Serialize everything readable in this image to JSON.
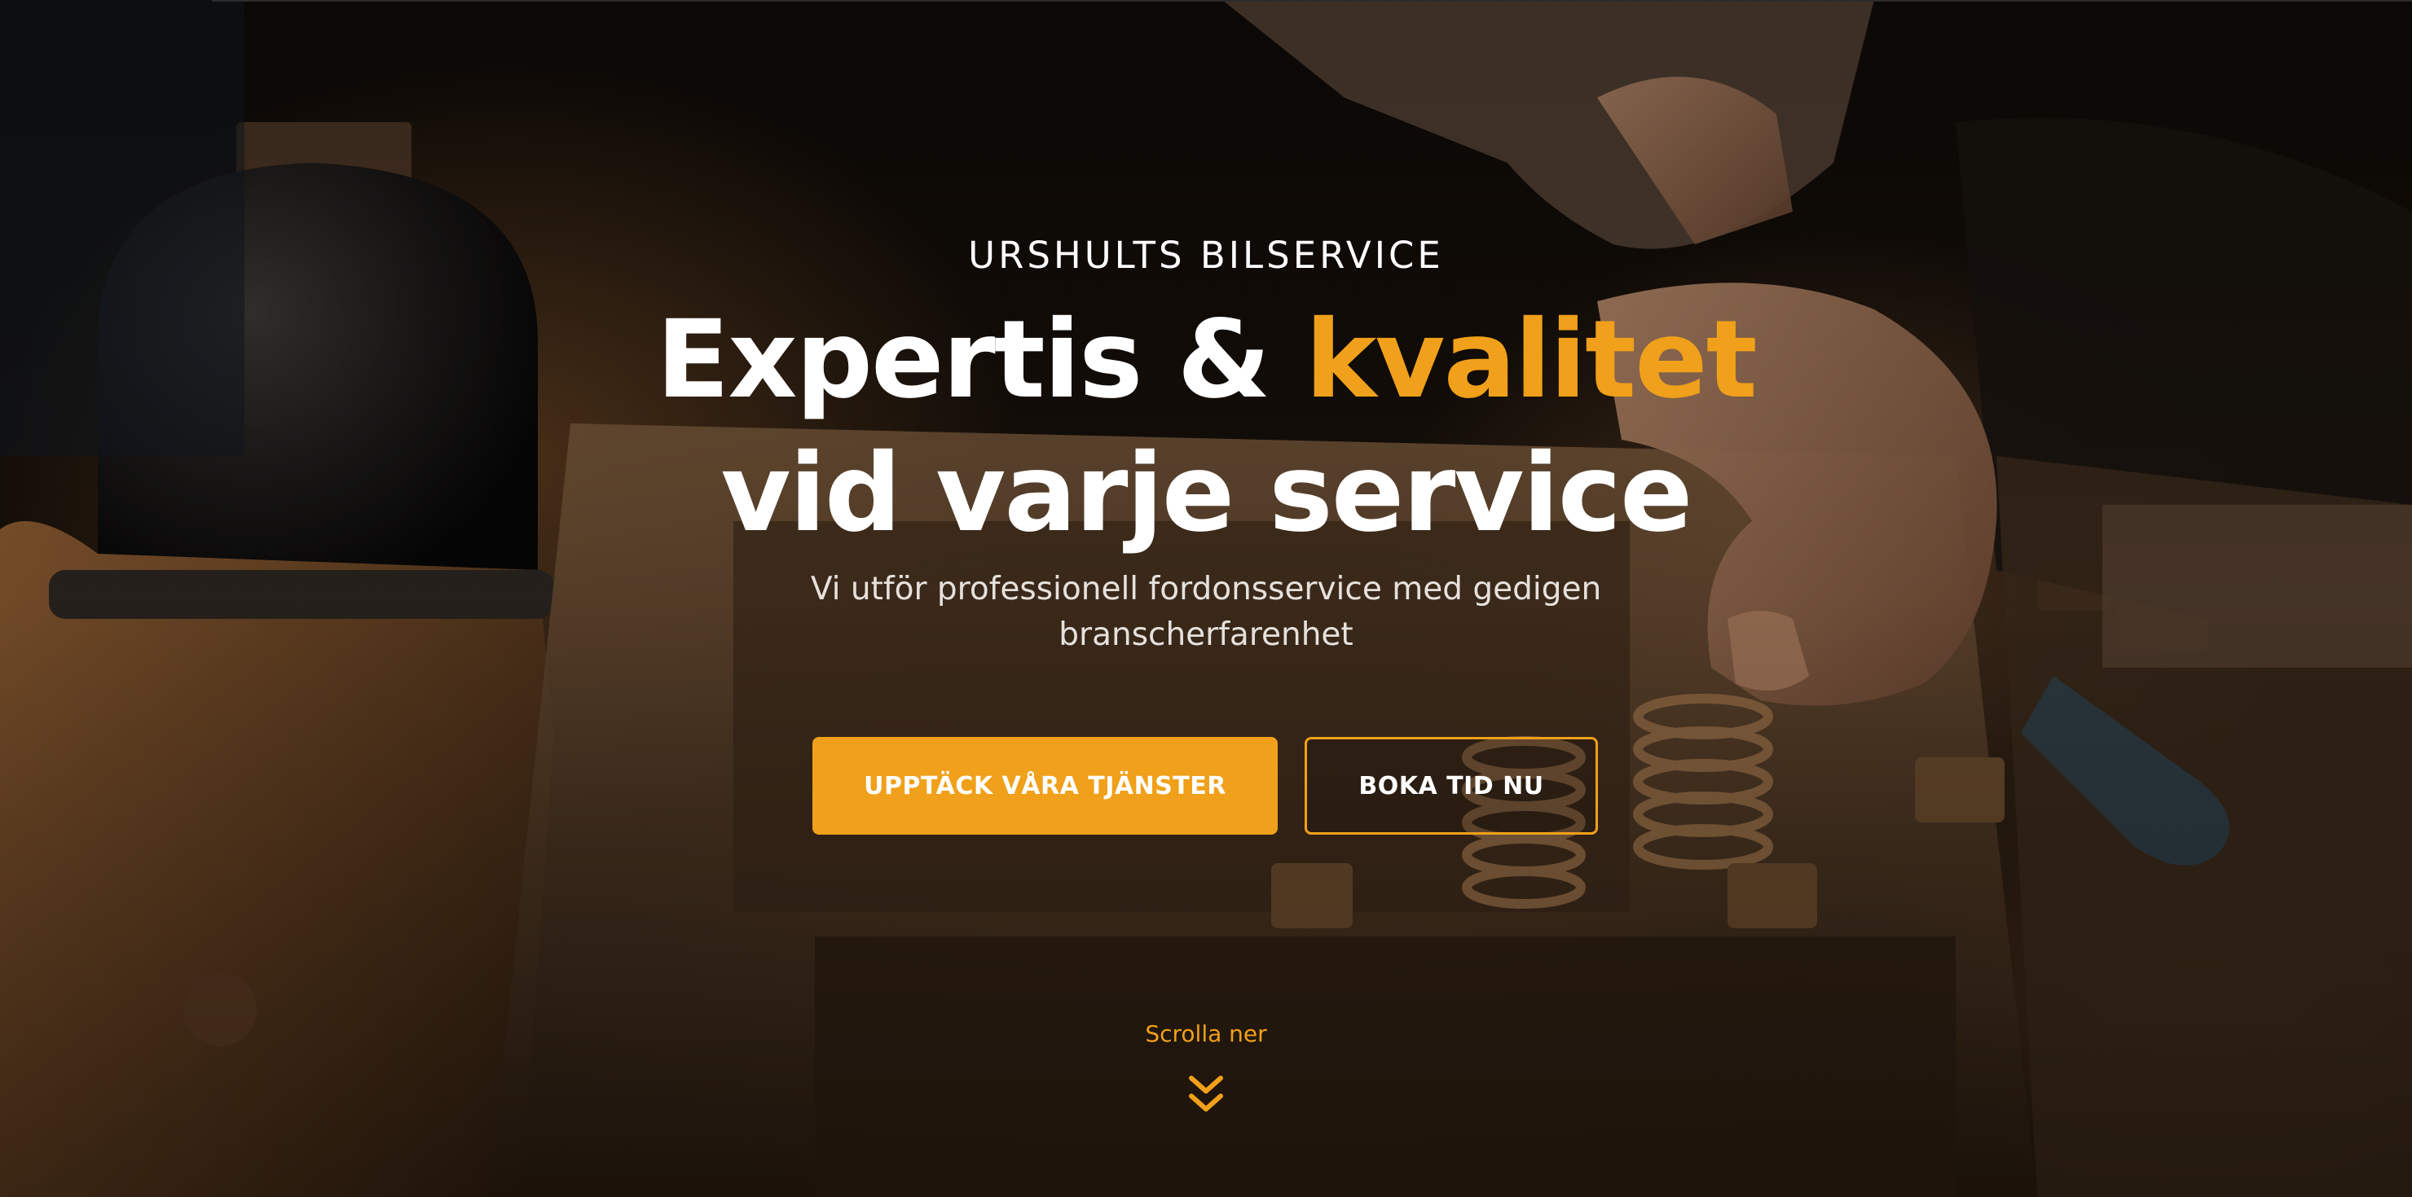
{
  "hero": {
    "eyebrow": "URSHULTS BILSERVICE",
    "headline_line1_part1": "Expertis & ",
    "headline_line1_accent": "kvalitet",
    "headline_line2": "vid varje service",
    "subtitle": "Vi utför professionell fordonsservice med gedigen branscherfarenhet",
    "primary_button": "UPPTÄCK VÅRA TJÄNSTER",
    "secondary_button": "BOKA TID NU",
    "scroll_label": "Scrolla ner",
    "scroll_icon": "double-chevron-down-icon"
  },
  "colors": {
    "accent": "#f0a01a",
    "text": "#ffffff",
    "background": "#0b0805"
  }
}
